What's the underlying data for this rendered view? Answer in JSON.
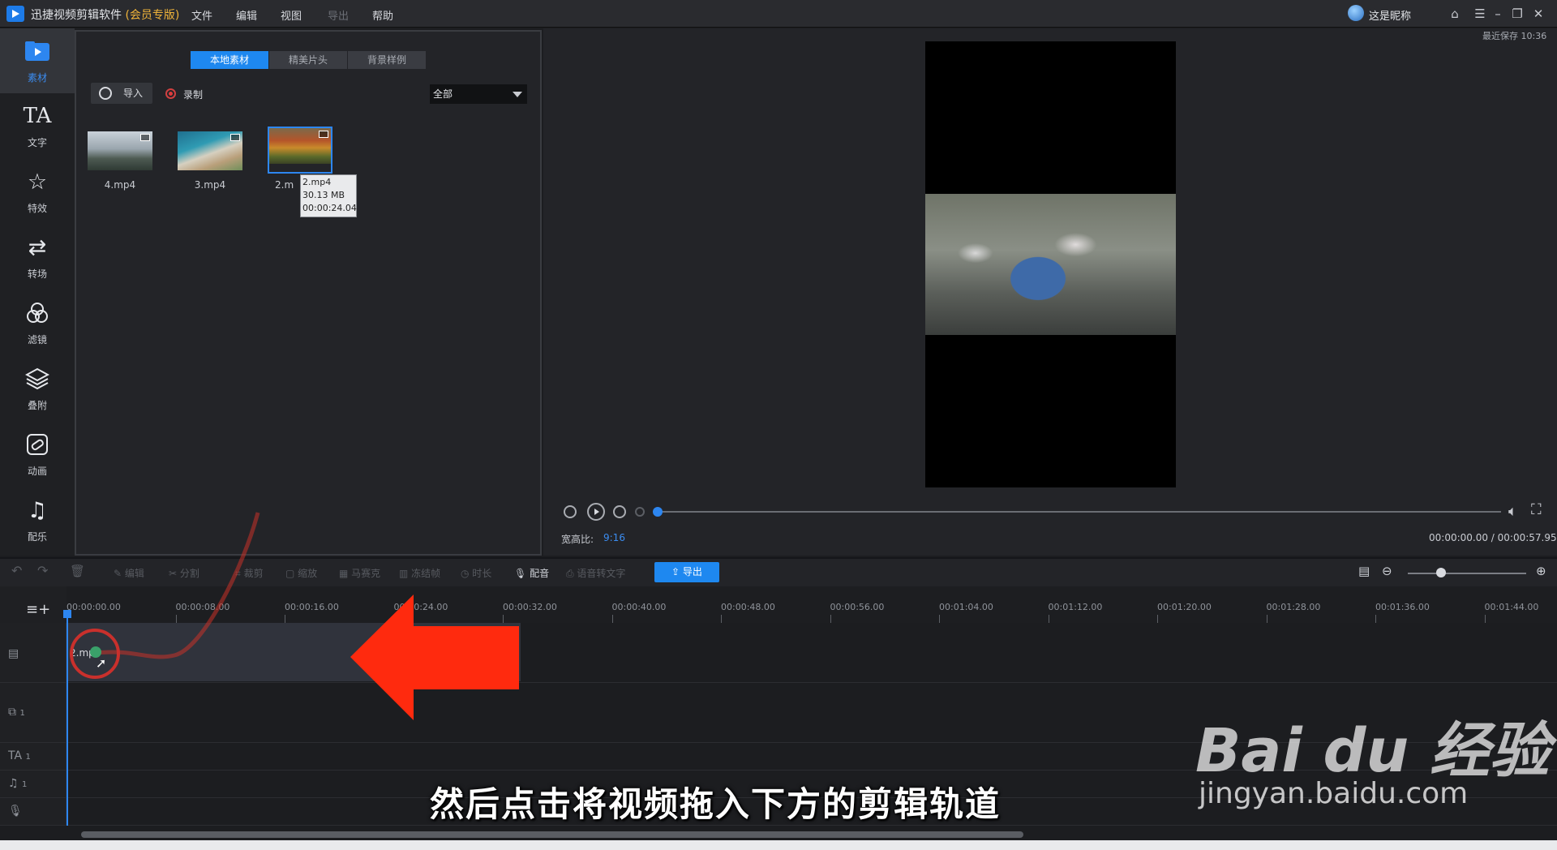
{
  "titlebar": {
    "app_name": "迅捷视频剪辑软件",
    "edition": "(会员专版)",
    "menus": [
      "文件",
      "编辑",
      "视图",
      "导出",
      "帮助"
    ],
    "user_name": "这是昵称",
    "last_saved": "最近保存 10:36"
  },
  "sidebar": {
    "items": [
      {
        "label": "素材",
        "icon": "media-icon"
      },
      {
        "label": "文字",
        "icon": "text-icon"
      },
      {
        "label": "特效",
        "icon": "effects-icon"
      },
      {
        "label": "转场",
        "icon": "transition-icon"
      },
      {
        "label": "滤镜",
        "icon": "filter-icon"
      },
      {
        "label": "叠附",
        "icon": "overlay-icon"
      },
      {
        "label": "动画",
        "icon": "animation-icon"
      },
      {
        "label": "配乐",
        "icon": "music-icon"
      }
    ]
  },
  "media": {
    "tabs": [
      "本地素材",
      "精美片头",
      "背景样例"
    ],
    "import_label": "导入",
    "record_label": "录制",
    "filter_value": "全部",
    "files": [
      {
        "name": "4.mp4"
      },
      {
        "name": "3.mp4"
      },
      {
        "name": "2.mp4"
      }
    ],
    "selected_label_visible": "2.m",
    "tooltip": {
      "name": "2.mp4",
      "size": "30.13 MB",
      "duration": "00:00:24.04"
    }
  },
  "preview": {
    "aspect_label": "宽高比:",
    "aspect_value": "9:16",
    "time": "00:00:00.00 / 00:00:57.95",
    "progress_fraction": 0
  },
  "timeline": {
    "tools": [
      "编辑",
      "分割",
      "裁剪",
      "缩放",
      "马赛克",
      "冻结帧",
      "时长",
      "配音",
      "语音转文字"
    ],
    "export_label": "导出",
    "ticks": [
      "00:00:00.00",
      "00:00:08.00",
      "00:00:16.00",
      "00:00:24.00",
      "00:00:32.00",
      "00:00:40.00",
      "00:00:48.00",
      "00:00:56.00",
      "00:01:04.00",
      "00:01:12.00",
      "00:01:20.00",
      "00:01:28.00",
      "00:01:36.00",
      "00:01:44.00"
    ],
    "clip_label": "2.mp4",
    "track_numbers": [
      "1",
      "1",
      "1"
    ]
  },
  "overlay": {
    "caption": "然后点击将视频拖入下方的剪辑轨道",
    "watermark_main": "Bai du 经验",
    "watermark_sub": "jingyan.baidu.com"
  },
  "colors": {
    "accent": "#1e88f0",
    "vip": "#f0b43a",
    "arrow": "#ff2a0e"
  }
}
